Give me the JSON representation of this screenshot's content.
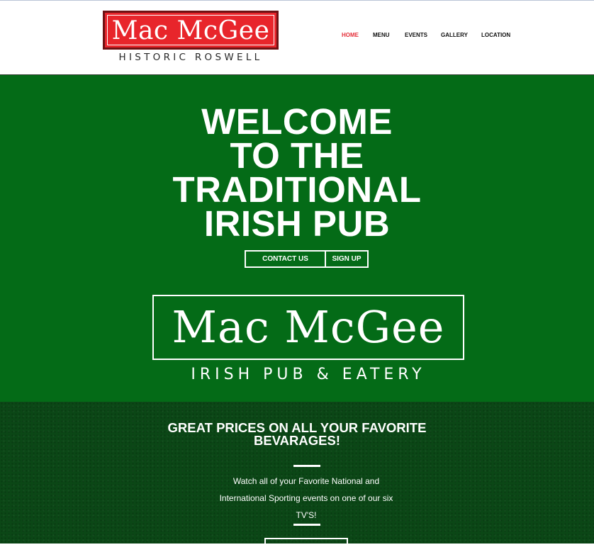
{
  "header": {
    "logo_title": "Mac McGee",
    "logo_subtitle": "HISTORIC ROSWELL",
    "nav": [
      {
        "label": "HOME",
        "active": true
      },
      {
        "label": "MENU"
      },
      {
        "label": "EVENTS"
      },
      {
        "label": "GALLERY"
      },
      {
        "label": "LOCATION"
      }
    ]
  },
  "hero": {
    "title_lines": [
      "WELCOME",
      "TO THE",
      "TRADITIONAL",
      "IRISH PUB"
    ],
    "contact_label": "CONTACT US",
    "signup_label": "SIGN UP",
    "logo_title": "Mac McGee",
    "logo_subtitle": "IRISH PUB & EATERY"
  },
  "promo": {
    "title_lines": [
      "GREAT PRICES ON ALL YOUR FAVORITE",
      "BEVARAGES!"
    ],
    "text_lines": [
      "Watch all of your Favorite National and",
      "International Sporting events on one of our six",
      "TV'S!"
    ]
  },
  "colors": {
    "brand_red": "#e8252b",
    "hero_green": "#046b17",
    "promo_green": "#0b4716",
    "nav_active": "#e5303a"
  }
}
